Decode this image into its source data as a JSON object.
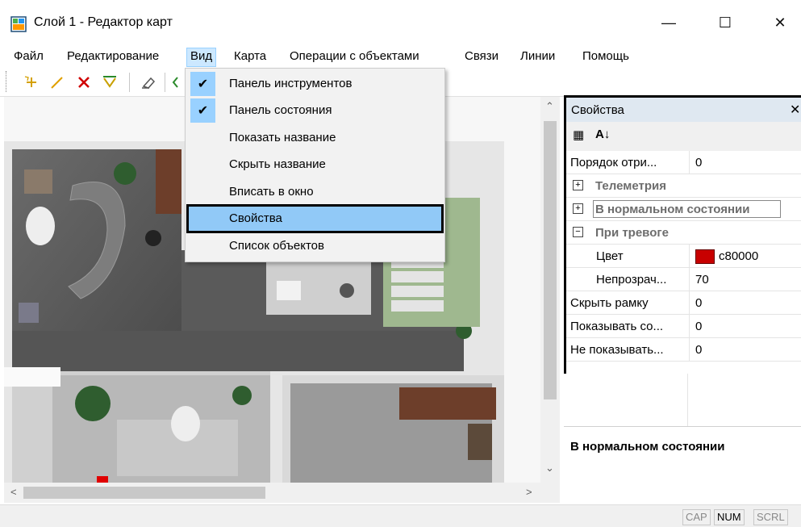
{
  "window": {
    "title": "Слой 1 - Редактор карт",
    "min_glyph": "—",
    "max_glyph": "☐",
    "close_glyph": "✕"
  },
  "menubar": {
    "items": [
      "Файл",
      "Редактирование",
      "Вид",
      "Карта",
      "Операции с объектами",
      "Связи",
      "Линии",
      "Помощь"
    ],
    "open_item": "Вид"
  },
  "toolbar": {
    "icons": [
      "add-object-icon",
      "draw-line-icon",
      "delete-icon",
      "select-icon",
      "eraser-icon",
      "move-icon"
    ]
  },
  "view_menu": {
    "items": [
      {
        "label": "Панель инструментов",
        "checked": true
      },
      {
        "label": "Панель состояния",
        "checked": true
      },
      {
        "label": "Показать название",
        "checked": false
      },
      {
        "label": "Скрыть название",
        "checked": false
      },
      {
        "label": "Вписать в окно",
        "checked": false
      },
      {
        "label": "Свойства",
        "checked": false,
        "highlighted": true
      },
      {
        "label": "Список объектов",
        "checked": false
      }
    ],
    "check_glyph": "✔"
  },
  "properties": {
    "title": "Свойства",
    "close_glyph": "✕",
    "tool_categorized": "▦",
    "tool_alpha": "A↓",
    "rows": [
      {
        "name": "Порядок отри...",
        "value": "0",
        "kind": "prop"
      },
      {
        "name": "Телеметрия",
        "value": "",
        "kind": "cat",
        "expander": "+"
      },
      {
        "name": "В нормальном состоянии",
        "value": "",
        "kind": "cat",
        "expander": "+"
      },
      {
        "name": "При тревоге",
        "value": "",
        "kind": "cat",
        "expander": "−"
      },
      {
        "name": "Цвет",
        "value": "c80000",
        "kind": "sub"
      },
      {
        "name": "Непрозрач...",
        "value": "70",
        "kind": "sub"
      },
      {
        "name": "Скрыть рамку",
        "value": "0",
        "kind": "prop"
      },
      {
        "name": "Показывать со...",
        "value": "0",
        "kind": "prop"
      },
      {
        "name": "Не показывать...",
        "value": "0",
        "kind": "prop"
      }
    ],
    "swatch_color": "#c80000",
    "description_title": "В нормальном состоянии"
  },
  "statusbar": {
    "indicators": [
      {
        "label": "CAP",
        "active": false
      },
      {
        "label": "NUM",
        "active": true
      },
      {
        "label": "SCRL",
        "active": false
      }
    ]
  },
  "scroll": {
    "up": "⌃",
    "down": "⌄",
    "left": "<",
    "right": ">"
  }
}
